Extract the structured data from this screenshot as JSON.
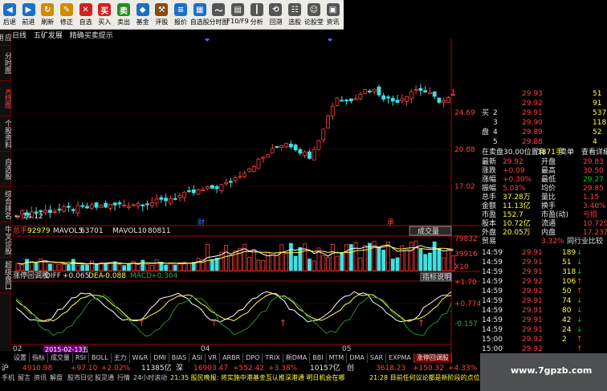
{
  "toolbar": {
    "buttons": [
      {
        "label": "后退",
        "icon": "back-arrow-icon",
        "color": "#1c6fc9"
      },
      {
        "label": "前进",
        "icon": "forward-arrow-icon",
        "color": "#1c6fc9"
      },
      {
        "label": "刷新",
        "icon": "refresh-icon",
        "color": "#d08b00"
      },
      {
        "label": "修正",
        "icon": "correct-icon",
        "color": "#d08b00"
      },
      {
        "label": "自选",
        "icon": "star-icon",
        "color": "#d02020"
      },
      {
        "label": "买入",
        "icon": "buy-icon",
        "color": "#d02020"
      },
      {
        "label": "卖出",
        "icon": "sell-icon",
        "color": "#2a8a2a"
      },
      {
        "label": "基金",
        "icon": "fund-icon",
        "color": "#1c6fc9"
      },
      {
        "label": "评股",
        "icon": "gavel-icon",
        "color": "#8a4a10"
      },
      {
        "label": "报价",
        "icon": "quote-icon",
        "color": "#1c6fc9"
      },
      {
        "label": "自选股",
        "icon": "grid-icon",
        "color": "#1c6fc9"
      },
      {
        "label": "分时图",
        "icon": "timeline-icon",
        "color": "#555555"
      },
      {
        "label": "F10/F9",
        "icon": "document-icon",
        "color": "#555555"
      },
      {
        "label": "分析",
        "icon": "kline-icon",
        "color": "#555555"
      },
      {
        "label": "回溯",
        "icon": "rewind-icon",
        "color": "#555555"
      },
      {
        "label": "选股",
        "icon": "select-stock-icon",
        "color": "#555555"
      },
      {
        "label": "论股堂",
        "icon": "forum-icon",
        "color": "#555555"
      },
      {
        "label": "资讯",
        "icon": "news-icon",
        "color": "#555555"
      }
    ]
  },
  "left_tabs": [
    "应用",
    "分时图",
    "K线图",
    "个股资料",
    "自选股",
    "综合排名",
    "牛叉诊股",
    "超级盘口"
  ],
  "chart_header": {
    "period": "日线",
    "stock": "五矿发展",
    "indicator": "精确买卖提示"
  },
  "price_axis": [
    "24.69",
    "20.88",
    "17.02"
  ],
  "price_min_label": "14.12",
  "event_markers": [
    "财",
    "承"
  ],
  "volume_header": {
    "label": "总手",
    "total": "92979",
    "mavol5_label": "MAVOL5",
    "mavol5": "63701",
    "mavol10_label": "MAVOL10",
    "mavol10": "80811",
    "button": "成交量"
  },
  "volume_axis": [
    "79832",
    "39916",
    "X10"
  ],
  "macd_header": {
    "name": "涨停回调股",
    "diff_label": "DIFF",
    "diff": "+0.065",
    "dea_label": "DEA",
    "dea": "-0.088",
    "macd_label": "MACD",
    "macd": "+0.304",
    "button": "指标说明"
  },
  "macd_axis": [
    "+1.70",
    "+0.774",
    "-0.157"
  ],
  "date_axis": {
    "left": "02",
    "highlight": "2015-02-13五",
    "mid": "04",
    "right": "05"
  },
  "indicator_tabs": [
    "设置",
    "指标",
    "成交量",
    "RSI",
    "BOLL",
    "主力",
    "W&R",
    "DMI",
    "BIAS",
    "ASI",
    "VR",
    "ARBR",
    "DPO",
    "TRIX",
    "新DMA",
    "BBI",
    "MTM",
    "DMA",
    "SAR",
    "EXPMA",
    "涨停回调股"
  ],
  "ticker": {
    "label": "沪",
    "sh_index": "4910.98",
    "sh_change": "+97.10",
    "sh_pct": "+2.02%",
    "sh_amount": "11385亿",
    "sz_label": "深",
    "sz_index": "16903.47",
    "sz_change": "+552.42",
    "sz_pct": "+3.38%",
    "sz_amount": "10157亿",
    "cy_label": "创",
    "cy_index": "3618.23",
    "cy_change": "+150.32",
    "cy_pct": "+4.33%"
  },
  "status_bar": {
    "items": [
      "手机",
      "留言",
      "资讯",
      "解盘",
      "股市日记",
      "股灵通",
      "行情",
      "24小时滚动"
    ],
    "news1": "21:35 股民晚报: 将实施中港基金互认推深港通 明日机会在哪",
    "news2": "21:28 目前任何议论都是新阶段的点位都是"
  },
  "quote": {
    "ask_rows": [
      {
        "label": "",
        "price": "29.93",
        "vol": "51"
      },
      {
        "label": "",
        "price": "29.92",
        "vol": "91"
      },
      {
        "label": "买",
        "price": "29.91",
        "vol": "537"
      },
      {
        "label": "",
        "price": "29.90",
        "vol": "118"
      },
      {
        "label": "盘",
        "price": "29.89",
        "vol": "52"
      },
      {
        "label": "",
        "price": "29.88",
        "vol": "4"
      }
    ],
    "ask_numbers": [
      "",
      "2",
      "3",
      "4",
      "5"
    ],
    "order_note": "在卖盘30.00位置有",
    "order_vol": "1871手",
    "order_sell": "卖单",
    "order_link": "查看详细",
    "stats": [
      {
        "k1": "最新",
        "v1": "29.92",
        "k2": "开盘",
        "v2": "29.83"
      },
      {
        "k1": "涨跌",
        "v1": "+0.09",
        "k2": "最高",
        "v2": "30.50"
      },
      {
        "k1": "涨幅",
        "v1": "+0.30%",
        "k2": "最低",
        "v2": "29.27"
      },
      {
        "k1": "振幅",
        "v1": "5.03%",
        "k2": "均价",
        "v2": "29.85"
      },
      {
        "k1": "总手",
        "v1": "37.28万",
        "k2": "量比",
        "v2": "1.15"
      },
      {
        "k1": "金额",
        "v1": "11.13亿",
        "k2": "换手",
        "v2": "3.40%"
      },
      {
        "k1": "市盈",
        "v1": "152.7",
        "k2": "市盈(动)",
        "v2": "亏损"
      },
      {
        "k1": "股本",
        "v1": "10.72亿",
        "k2": "流通",
        "v2": "10.72亿"
      },
      {
        "k1": "外盘",
        "v1": "20.05万",
        "k2": "内盘",
        "v2": "17.23万"
      }
    ],
    "industry": {
      "label": "贸易",
      "pct": "3.32%",
      "link": "同行业比较"
    },
    "ticks": [
      {
        "time": "14:59",
        "price": "29.91",
        "vol": "189",
        "dir": "down"
      },
      {
        "time": "14:59",
        "price": "29.91",
        "vol": "51",
        "dir": "down"
      },
      {
        "time": "14:59",
        "price": "29.91",
        "vol": "318",
        "dir": "down"
      },
      {
        "time": "14:59",
        "price": "29.92",
        "vol": "106",
        "dir": "up"
      },
      {
        "time": "14:59",
        "price": "29.92",
        "vol": "50",
        "dir": "up"
      },
      {
        "time": "14:59",
        "price": "29.91",
        "vol": "74",
        "dir": "down"
      },
      {
        "time": "14:59",
        "price": "29.91",
        "vol": "80",
        "dir": "down"
      },
      {
        "time": "14:59",
        "price": "29.91",
        "vol": "42",
        "dir": "down"
      },
      {
        "time": "14:59",
        "price": "29.91",
        "vol": "24",
        "dir": "down"
      },
      {
        "time": "15:00",
        "price": "29.92",
        "vol": "2",
        "dir": "up"
      },
      {
        "time": "15:00",
        "price": "29.92",
        "vol": "",
        "dir": "up"
      }
    ]
  },
  "watermark": "www.7gpzb.com",
  "colors": {
    "up": "#ff4040",
    "down": "#40e0e0",
    "axis": "#b00000",
    "gridline": "#7a0000"
  }
}
